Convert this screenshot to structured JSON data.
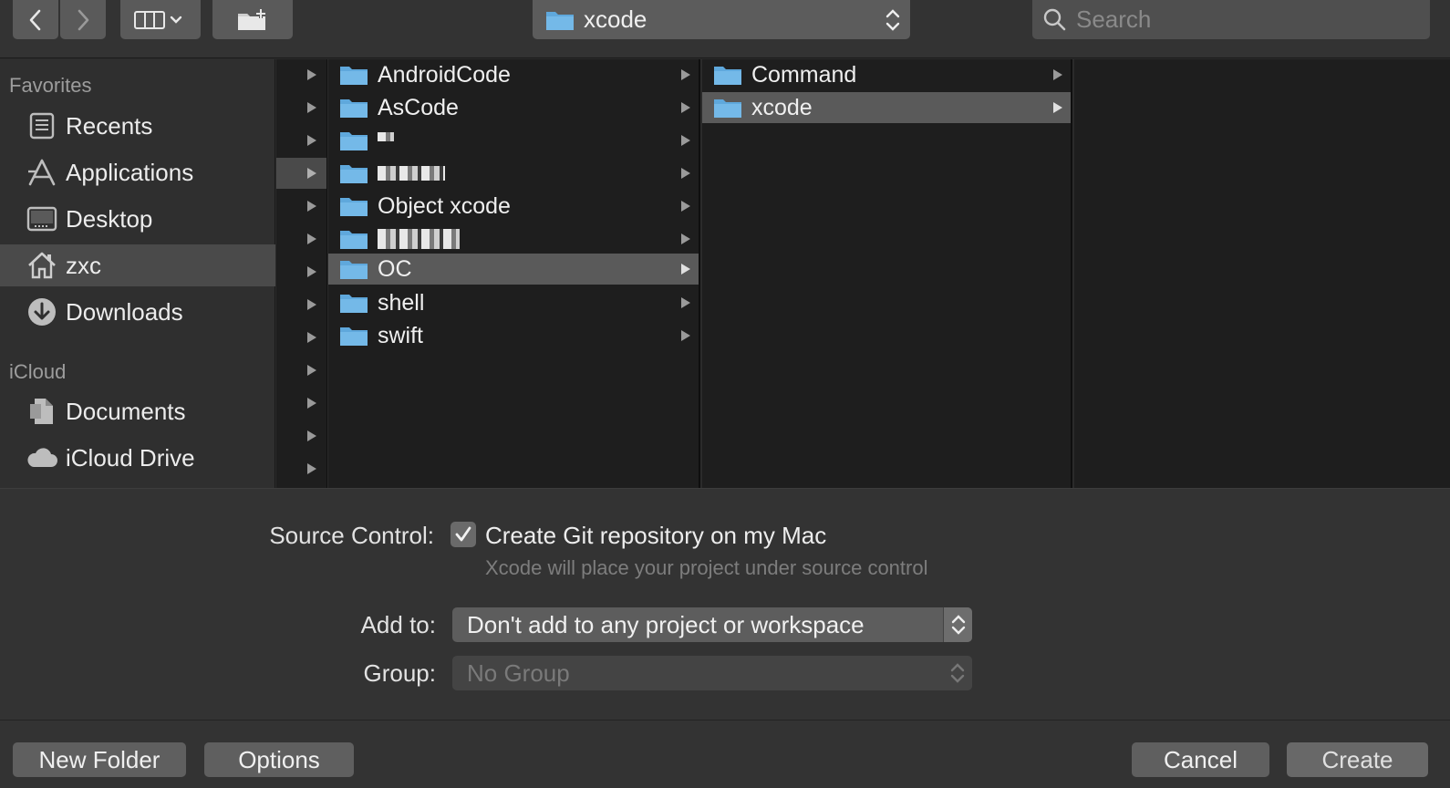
{
  "toolbar": {
    "path_label": "xcode",
    "search_placeholder": "Search"
  },
  "sidebar": {
    "favorites_header": "Favorites",
    "icloud_header": "iCloud",
    "items": [
      {
        "label": "Recents",
        "icon": "recents-icon"
      },
      {
        "label": "Applications",
        "icon": "applications-icon"
      },
      {
        "label": "Desktop",
        "icon": "desktop-icon"
      },
      {
        "label": "zxc",
        "icon": "home-icon",
        "selected": true
      },
      {
        "label": "Downloads",
        "icon": "downloads-icon"
      },
      {
        "label": "Documents",
        "icon": "documents-icon"
      },
      {
        "label": "iCloud Drive",
        "icon": "icloud-drive-icon"
      }
    ]
  },
  "column2": {
    "items": [
      {
        "label": "AndroidCode"
      },
      {
        "label": "AsCode"
      },
      {
        "label": ""
      },
      {
        "label": ""
      },
      {
        "label": "Object xcode"
      },
      {
        "label": ""
      },
      {
        "label": "OC",
        "selected": true
      },
      {
        "label": "shell"
      },
      {
        "label": "swift"
      }
    ]
  },
  "column3": {
    "items": [
      {
        "label": "Command"
      },
      {
        "label": "xcode",
        "selected": true
      }
    ]
  },
  "options": {
    "source_control_label": "Source Control:",
    "git_checkbox_label": "Create Git repository on my Mac",
    "git_checked": true,
    "git_hint": "Xcode will place your project under source control",
    "add_to_label": "Add to:",
    "add_to_value": "Don't add to any project or workspace",
    "group_label": "Group:",
    "group_value": "No Group"
  },
  "footer": {
    "new_folder": "New Folder",
    "options": "Options",
    "cancel": "Cancel",
    "create": "Create"
  }
}
